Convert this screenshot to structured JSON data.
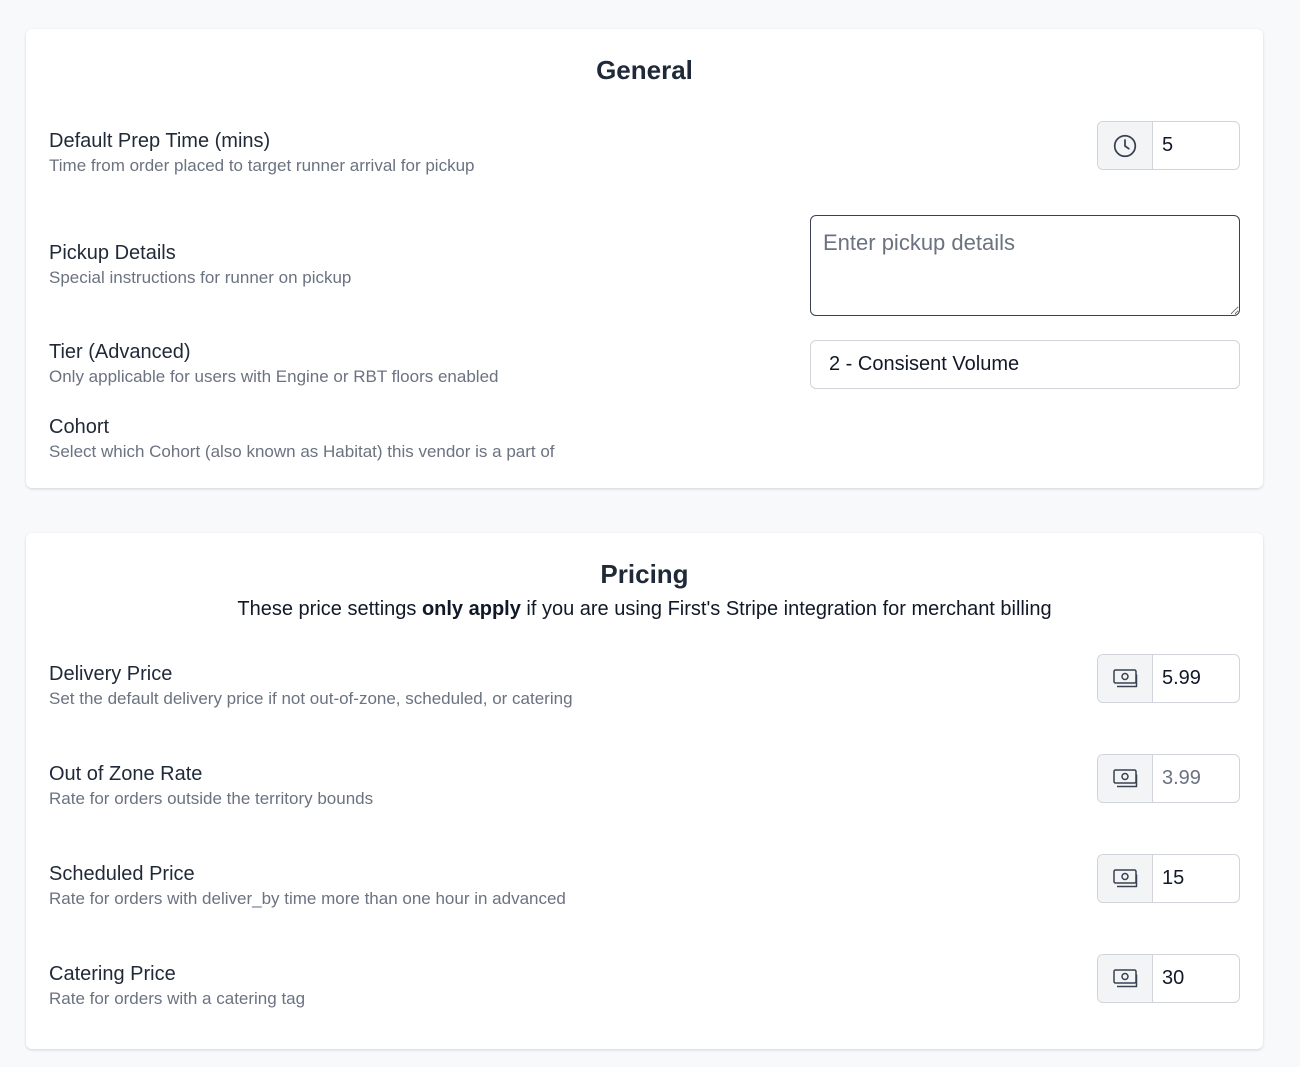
{
  "general": {
    "title": "General",
    "prep_time": {
      "label": "Default Prep Time (mins)",
      "description": "Time from order placed to target runner arrival for pickup",
      "value": "5",
      "icon": "clock-icon"
    },
    "pickup_details": {
      "label": "Pickup Details",
      "description": "Special instructions for runner on pickup",
      "value": "",
      "placeholder": "Enter pickup details"
    },
    "tier": {
      "label": "Tier (Advanced)",
      "description": "Only applicable for users with Engine or RBT floors enabled",
      "selected": "2 - Consisent Volume"
    },
    "cohort": {
      "label": "Cohort",
      "description": "Select which Cohort (also known as Habitat) this vendor is a part of"
    }
  },
  "pricing": {
    "title": "Pricing",
    "subtitle": {
      "before": "These price settings ",
      "bold": "only apply",
      "after": " if you are using First's Stripe integration for merchant billing"
    },
    "delivery_price": {
      "label": "Delivery Price",
      "description": "Set the default delivery price if not out-of-zone, scheduled, or catering",
      "value": "5.99",
      "icon": "cash-icon"
    },
    "out_of_zone_rate": {
      "label": "Out of Zone Rate",
      "description": "Rate for orders outside the territory bounds",
      "value": "",
      "placeholder": "3.99",
      "icon": "cash-icon"
    },
    "scheduled_price": {
      "label": "Scheduled Price",
      "description": "Rate for orders with deliver_by time more than one hour in advanced",
      "value": "15",
      "icon": "cash-icon"
    },
    "catering_price": {
      "label": "Catering Price",
      "description": "Rate for orders with a catering tag",
      "value": "30",
      "icon": "cash-icon"
    }
  },
  "colors": {
    "background": "#f8f9fb",
    "card": "#ffffff",
    "text": "#1f2937",
    "muted_text": "#6b7280",
    "border": "#d1d5db",
    "addon_bg": "#f3f4f6"
  }
}
